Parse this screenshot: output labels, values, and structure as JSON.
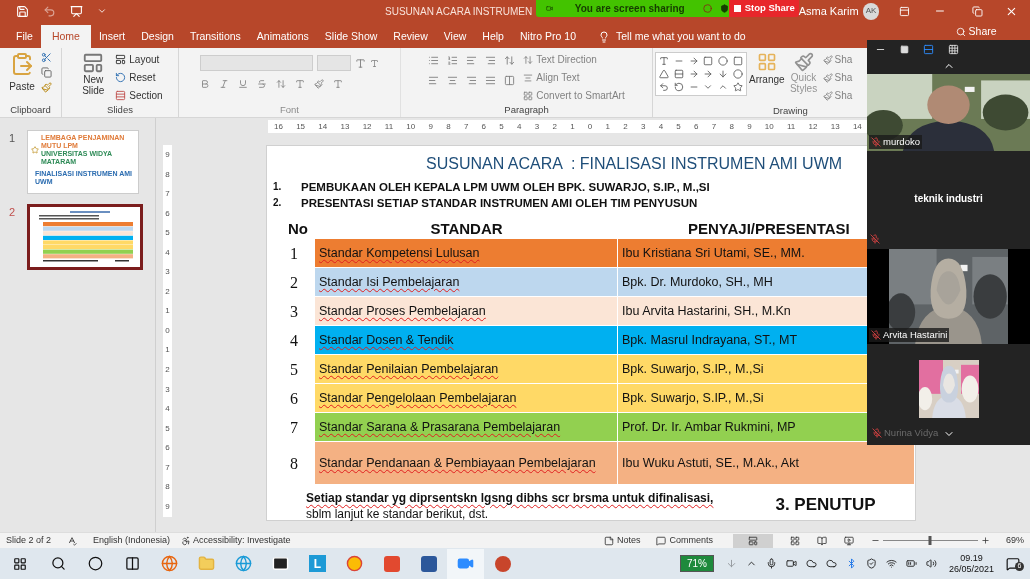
{
  "title_bar": {
    "title": "SUSUNAN ACARA INSTRUMEN",
    "user": "Asma Karim",
    "avatar": "AK"
  },
  "share_banner": {
    "message": "You are screen sharing",
    "stop": "Stop Share"
  },
  "ribbon_tabs": [
    {
      "label": "File",
      "selected": false
    },
    {
      "label": "Home",
      "selected": true
    },
    {
      "label": "Insert",
      "selected": false
    },
    {
      "label": "Design",
      "selected": false
    },
    {
      "label": "Transitions",
      "selected": false
    },
    {
      "label": "Animations",
      "selected": false
    },
    {
      "label": "Slide Show",
      "selected": false
    },
    {
      "label": "Review",
      "selected": false
    },
    {
      "label": "View",
      "selected": false
    },
    {
      "label": "Help",
      "selected": false
    },
    {
      "label": "Nitro Pro 10",
      "selected": false
    }
  ],
  "tell_me": "Tell me what you want to do",
  "share": "Share",
  "clipboard_group": {
    "paste": "Paste",
    "label": "Clipboard"
  },
  "slides_group": {
    "new_slide": "New Slide",
    "layout": "Layout",
    "reset": "Reset",
    "section": "Section",
    "label": "Slides"
  },
  "font_group": {
    "label": "Font"
  },
  "paragraph_group": {
    "text_direction": "Text Direction",
    "align_text": "Align Text",
    "convert": "Convert to SmartArt",
    "label": "Paragraph"
  },
  "drawing_group": {
    "arrange": "Arrange",
    "quick_styles": "Quick Styles",
    "shape_buttons": [
      "Sha",
      "Sha",
      "Sha"
    ],
    "label": "Drawing"
  },
  "thumbnails": [
    {
      "number": "1",
      "selected": false,
      "texts": [
        "LEMBAGA PENJAMINAN MUTU LPM",
        "UNIVERSITAS WIDYA MATARAM",
        "FINALISASI INSTRUMEN AMI UWM"
      ]
    },
    {
      "number": "2",
      "selected": true
    }
  ],
  "rulers": {
    "horizontal": [
      "16",
      "15",
      "14",
      "13",
      "12",
      "11",
      "10",
      "9",
      "8",
      "7",
      "6",
      "5",
      "4",
      "3",
      "2",
      "1",
      "0",
      "1",
      "2",
      "3",
      "4",
      "5",
      "6",
      "7",
      "8",
      "9",
      "10",
      "11",
      "12",
      "13",
      "14"
    ],
    "vertical": [
      "9",
      "8",
      "7",
      "6",
      "5",
      "4",
      "3",
      "2",
      "1",
      "0",
      "1",
      "2",
      "3",
      "4",
      "5",
      "6",
      "7",
      "8",
      "9"
    ]
  },
  "slide": {
    "title": "SUSUNAN ACARA  : FINALISASI INSTRUMEN AMI UWM",
    "agenda": [
      {
        "number": "1.",
        "text": "PEMBUKAAN OLEH KEPALA LPM UWM OLEH BPK. SUWARJO, S.IP., M.,SI"
      },
      {
        "number": "2.",
        "text": "PRESENTASI SETIAP STANDAR INSTRUMEN AMI OLEH TIM PENYUSUN"
      }
    ],
    "table": {
      "columns": [
        "No",
        "STANDAR",
        "PENYAJI/PRESENTASI"
      ],
      "rows": [
        {
          "no": "1",
          "standar": "Standar Kompetensi Lulusan",
          "presenter": "Ibu Kristiana Sri Utami, SE., MM.",
          "color": "#ed7d31"
        },
        {
          "no": "2",
          "standar": "Standar Isi Pembelajaran",
          "presenter": "Bpk. Dr. Murdoko, SH., MH",
          "color": "#bdd7ee"
        },
        {
          "no": "3",
          "standar": "Standar Proses Pembelajaran",
          "presenter": "Ibu Arvita Hastarini, SH., M.Kn",
          "color": "#fbe5d6"
        },
        {
          "no": "4",
          "standar": "Standar Dosen & Tendik",
          "presenter": "Bpk. Masrul Indrayana, ST., MT",
          "color": "#00b0f0"
        },
        {
          "no": "5",
          "standar": "Standar Penilaian Pembelajaran",
          "presenter": "Bpk. Suwarjo, S.IP., M.,Si",
          "color": "#ffd966"
        },
        {
          "no": "6",
          "standar": "Standar Pengelolaan Pembelajaran",
          "presenter": "Bpk. Suwarjo, S.IP., M.,Si",
          "color": "#ffd966"
        },
        {
          "no": "7",
          "standar": "Standar Sarana & Prasarana Pembelajaran",
          "presenter": "Prof. Dr. Ir. Ambar Rukmini, MP",
          "color": "#92d050"
        },
        {
          "no": "8",
          "standar": "Standar Pendanaan & Pembiayaan Pembelajaran",
          "presenter": "Ibu Wuku Astuti, SE., M.Ak., Akt",
          "color": "#f4b183"
        }
      ]
    },
    "note_bold": "Setiap standar yg diprsentskn lgsng dibhs scr brsma untuk difinalisasi,",
    "note_plain": "sblm lanjut ke standar berikut, dst.",
    "closing": "3. PENUTUP"
  },
  "meeting_panel": {
    "participants": [
      {
        "kind": "video",
        "name": "murdoko",
        "muted": true
      },
      {
        "kind": "name_only",
        "name": "teknik industri",
        "muted": true
      },
      {
        "kind": "video",
        "name": "Arvita Hastarini",
        "muted": true
      },
      {
        "name": "Nurina Vidya",
        "muted": true
      }
    ]
  },
  "status_bar": {
    "slide_info": "Slide 2 of 2",
    "language": "English (Indonesia)",
    "accessibility": "Accessibility: Investigate",
    "notes": "Notes",
    "comments": "Comments",
    "zoom": {
      "level": 0.5,
      "reading": "69%"
    }
  },
  "taskbar": {
    "launcher_letter": "L",
    "battery": "71%",
    "time": "09.19",
    "date": "26/05/2021",
    "notifications": "6"
  }
}
